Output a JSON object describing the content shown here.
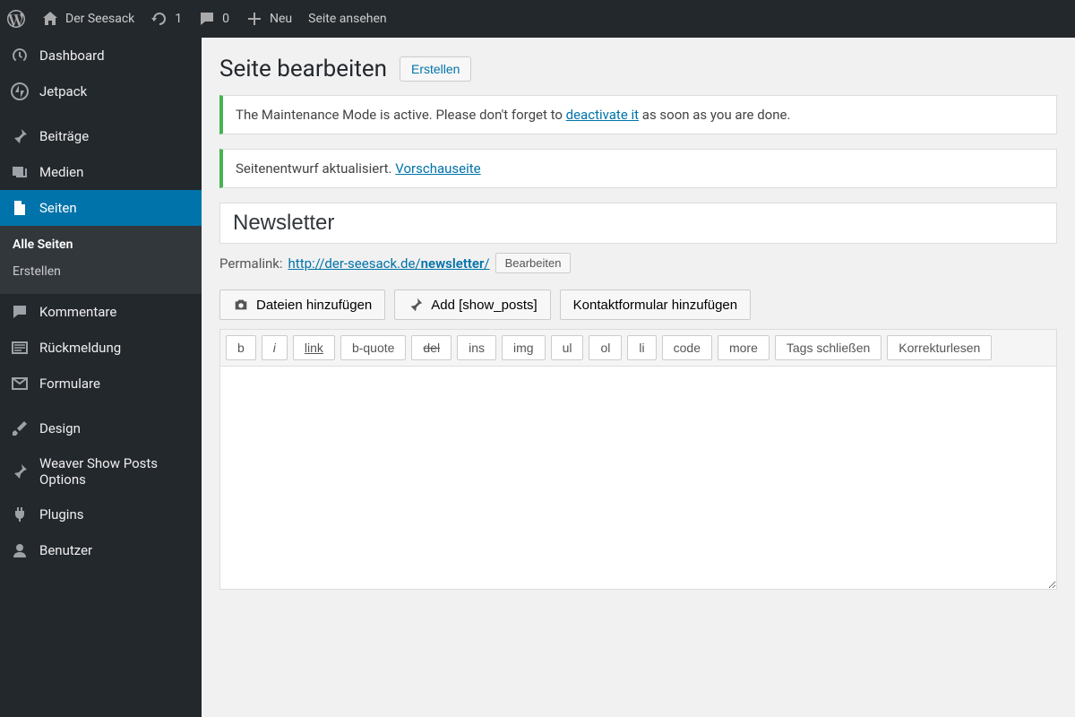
{
  "adminbar": {
    "site_name": "Der Seesack",
    "updates_count": "1",
    "comments_count": "0",
    "new_label": "Neu",
    "view_label": "Seite ansehen"
  },
  "sidebar": {
    "items": [
      {
        "label": "Dashboard"
      },
      {
        "label": "Jetpack"
      },
      {
        "label": "Beiträge"
      },
      {
        "label": "Medien"
      },
      {
        "label": "Seiten"
      },
      {
        "label": "Kommentare"
      },
      {
        "label": "Rückmeldung"
      },
      {
        "label": "Formulare"
      },
      {
        "label": "Design"
      },
      {
        "label": "Weaver Show Posts Options"
      },
      {
        "label": "Plugins"
      },
      {
        "label": "Benutzer"
      }
    ],
    "submenu": {
      "all": "Alle Seiten",
      "create": "Erstellen"
    }
  },
  "page": {
    "title": "Seite bearbeiten",
    "create_btn": "Erstellen"
  },
  "notices": {
    "maintenance_prefix": "The Maintenance Mode is active. Please don't forget to ",
    "maintenance_link": "deactivate it",
    "maintenance_suffix": " as soon as you are done.",
    "draft_prefix": "Seitenentwurf aktualisiert. ",
    "draft_link": "Vorschauseite"
  },
  "editor": {
    "title_value": "Newsletter",
    "permalink_label": "Permalink:",
    "permalink_base": "http://der-seesack.de/",
    "permalink_slug": "newsletter",
    "permalink_trail": "/",
    "edit_btn": "Bearbeiten"
  },
  "media_buttons": {
    "add_media": "Dateien hinzufügen",
    "add_showposts": "Add [show_posts]",
    "add_contact": "Kontaktformular hinzufügen"
  },
  "quicktags": {
    "b": "b",
    "i": "i",
    "link": "link",
    "bquote": "b-quote",
    "del": "del",
    "ins": "ins",
    "img": "img",
    "ul": "ul",
    "ol": "ol",
    "li": "li",
    "code": "code",
    "more": "more",
    "close": "Tags schließen",
    "proof": "Korrekturlesen"
  }
}
